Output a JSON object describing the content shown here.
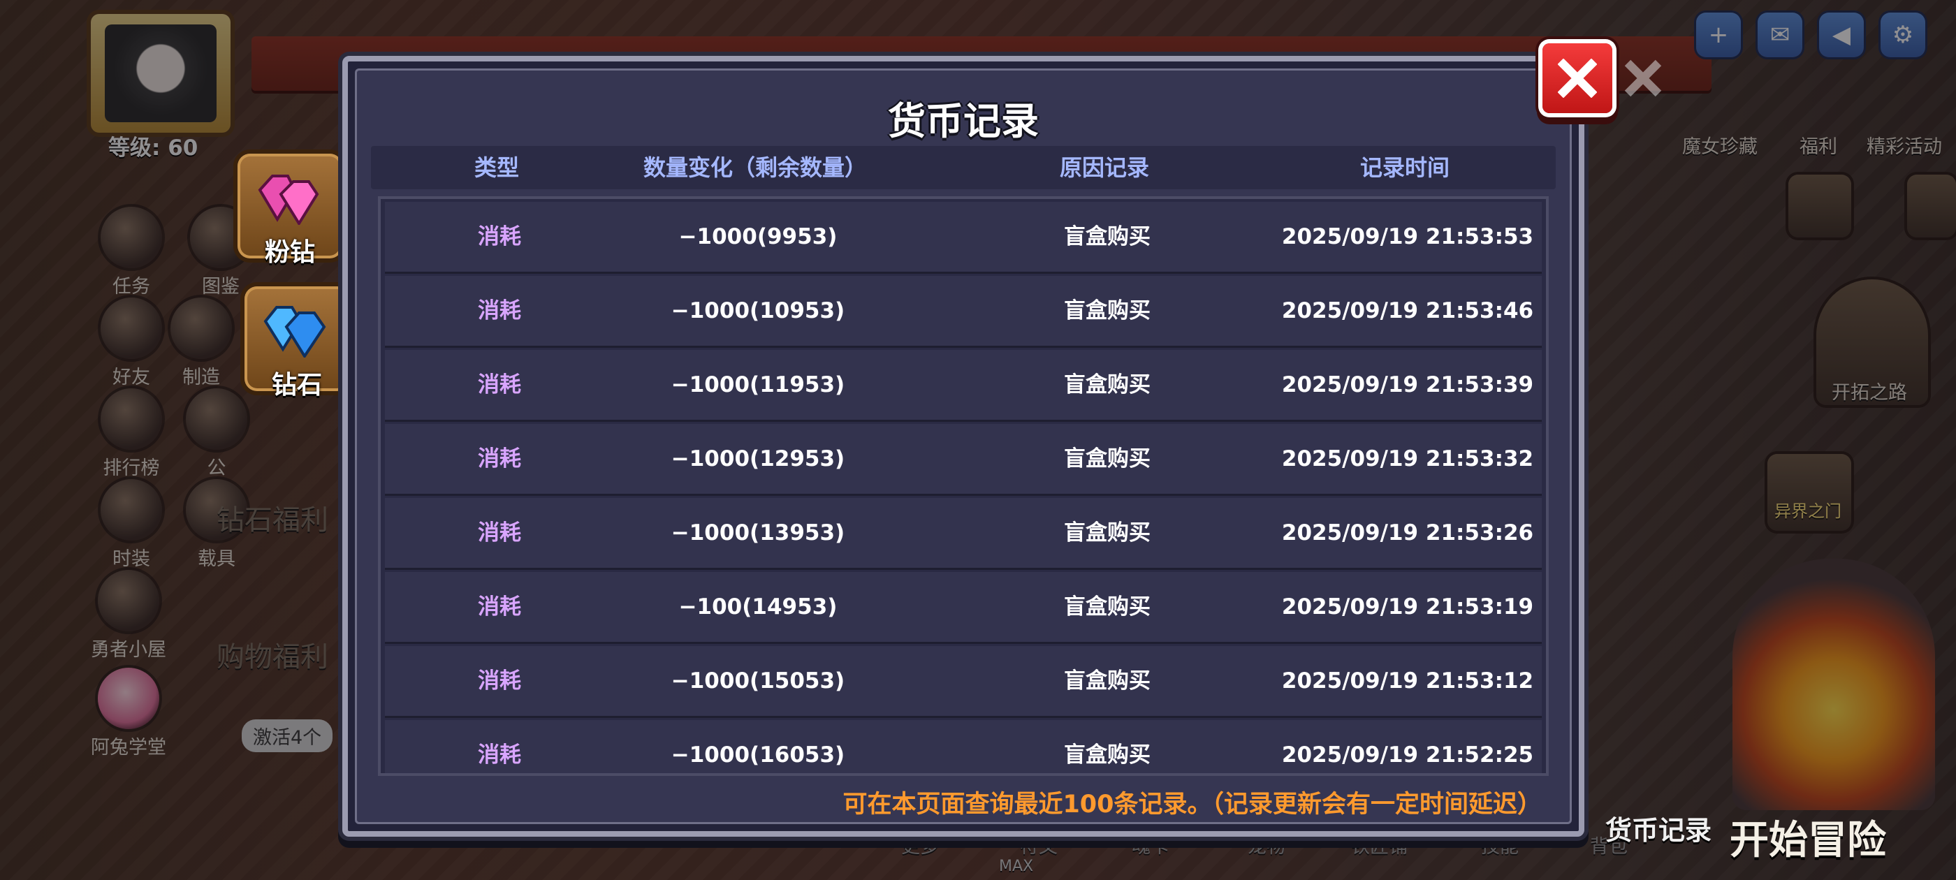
{
  "background": {
    "level": "等级: 60",
    "left_menu": [
      "任务",
      "图鉴",
      "好友",
      "制造",
      "排行榜",
      "公",
      "时装",
      "载具",
      "勇者小屋",
      "阿兔学堂"
    ],
    "left_overlays": [
      "钻石福利",
      "购物福利",
      "激活4个"
    ],
    "top_right_labels": [
      "魔女珍藏",
      "福利",
      "精彩活动"
    ],
    "right_labels": [
      "开拓之路",
      "异界之门"
    ],
    "bottom_nav": [
      "更多",
      "符文",
      "魂卡",
      "宠物",
      "铁匠铺",
      "技能",
      "背包"
    ],
    "bottom_extra": "MAX",
    "bottom_label": "货币记录",
    "start_button": "开始冒险"
  },
  "currency_tabs": [
    {
      "label": "粉钻",
      "icon": "pink-diamond-icon",
      "color": "#e94fb0"
    },
    {
      "label": "钻石",
      "icon": "blue-diamond-icon",
      "color": "#4fb8ff",
      "selected": true
    }
  ],
  "modal": {
    "title": "货币记录",
    "columns": [
      "类型",
      "数量变化（剩余数量）",
      "原因记录",
      "记录时间"
    ],
    "rows": [
      {
        "type": "消耗",
        "change": "−1000(9953)",
        "reason": "盲盒购买",
        "time": "2025/09/19 21:53:53"
      },
      {
        "type": "消耗",
        "change": "−1000(10953)",
        "reason": "盲盒购买",
        "time": "2025/09/19 21:53:46"
      },
      {
        "type": "消耗",
        "change": "−1000(11953)",
        "reason": "盲盒购买",
        "time": "2025/09/19 21:53:39"
      },
      {
        "type": "消耗",
        "change": "−1000(12953)",
        "reason": "盲盒购买",
        "time": "2025/09/19 21:53:32"
      },
      {
        "type": "消耗",
        "change": "−1000(13953)",
        "reason": "盲盒购买",
        "time": "2025/09/19 21:53:26"
      },
      {
        "type": "消耗",
        "change": "−100(14953)",
        "reason": "盲盒购买",
        "time": "2025/09/19 21:53:19"
      },
      {
        "type": "消耗",
        "change": "−1000(15053)",
        "reason": "盲盒购买",
        "time": "2025/09/19 21:53:12"
      },
      {
        "type": "消耗",
        "change": "−1000(16053)",
        "reason": "盲盒购买",
        "time": "2025/09/19 21:52:25"
      }
    ],
    "footnote": "可在本页面查询最近100条记录。（记录更新会有一定时间延迟）",
    "close_icon": "close-icon"
  },
  "colors": {
    "type_text": "#d9a5ff",
    "header_text": "#a5b8ff",
    "footnote": "#ff9a2e",
    "close_button": "#e02424"
  }
}
